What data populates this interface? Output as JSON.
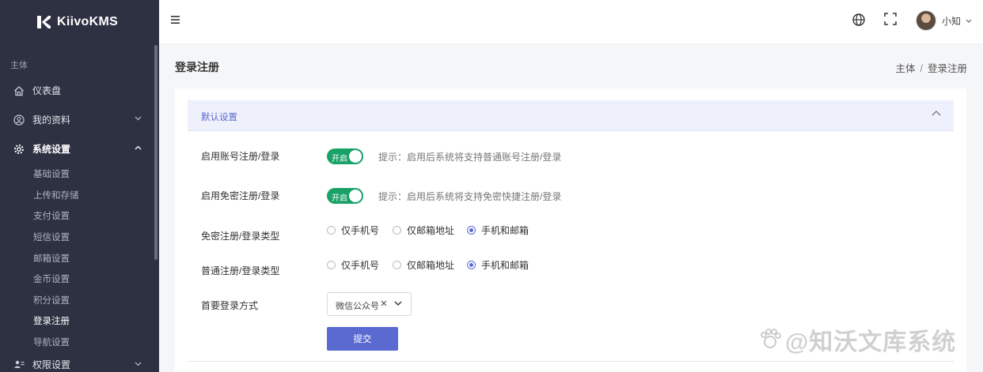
{
  "sidebar": {
    "brand": "KiivoKMS",
    "section": "主体",
    "items": [
      {
        "label": "仪表盘"
      },
      {
        "label": "我的资料"
      },
      {
        "label": "系统设置"
      }
    ],
    "subitems": [
      "基础设置",
      "上传和存储",
      "支付设置",
      "短信设置",
      "邮箱设置",
      "金币设置",
      "积分设置",
      "登录注册",
      "导航设置"
    ],
    "bottom_item": "权限设置"
  },
  "topbar": {
    "username": "小知"
  },
  "page": {
    "title": "登录注册",
    "breadcrumb": [
      "主体",
      "登录注册"
    ]
  },
  "form": {
    "collapse_title": "默认设置",
    "rows": {
      "account": {
        "label": "启用账号注册/登录",
        "switch_text": "开启",
        "hint": "提示：启用后系统将支持普通账号注册/登录"
      },
      "passwordless": {
        "label": "启用免密注册/登录",
        "switch_text": "开启",
        "hint": "提示：启用后系统将支持免密快捷注册/登录"
      },
      "passwordless_type": {
        "label": "免密注册/登录类型",
        "options": [
          "仅手机号",
          "仅邮箱地址",
          "手机和邮箱"
        ],
        "selected": "手机和邮箱"
      },
      "normal_type": {
        "label": "普通注册/登录类型",
        "options": [
          "仅手机号",
          "仅邮箱地址",
          "手机和邮箱"
        ],
        "selected": "手机和邮箱"
      },
      "primary_method": {
        "label": "首要登录方式",
        "value": "微信公众号"
      }
    },
    "submit_label": "提交"
  },
  "watermark": "@知沃文库系统",
  "colors": {
    "sidebar_bg": "#2d3142",
    "accent": "#5b6ad0",
    "switch_on": "#19a267"
  }
}
